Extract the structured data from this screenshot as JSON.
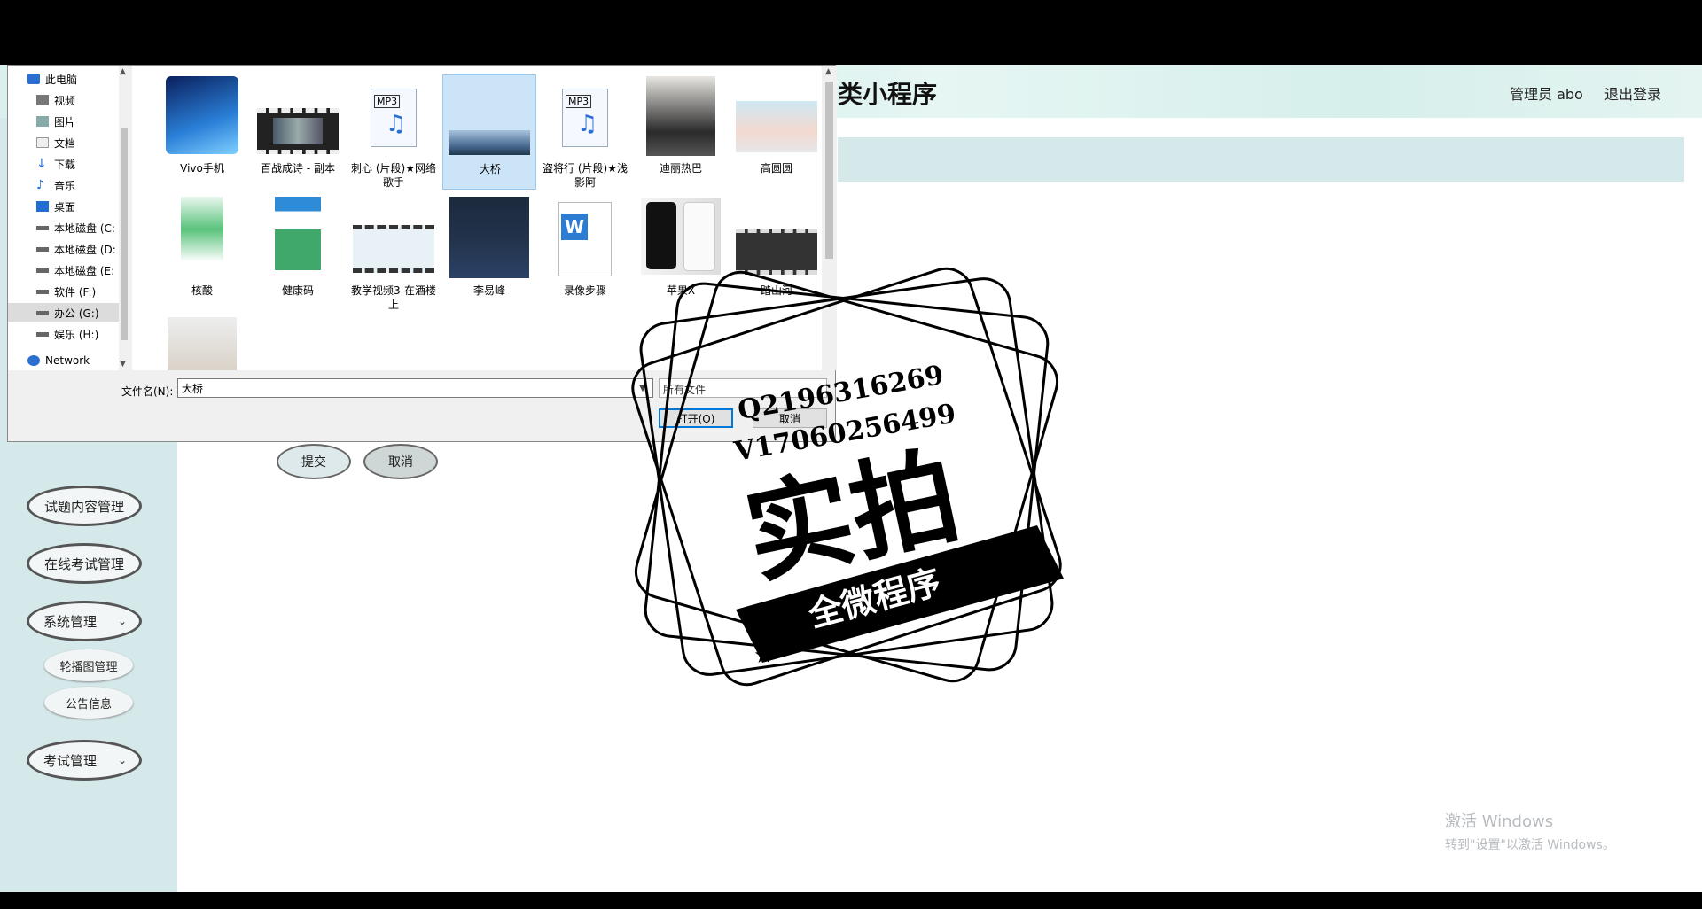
{
  "app": {
    "title": "类小程序",
    "admin_user": "管理员 abo",
    "logout": "退出登录"
  },
  "sidebar": {
    "menu": [
      {
        "label": "试题内容管理"
      },
      {
        "label": "在线考试管理"
      },
      {
        "label": "系统管理",
        "chevron": "chevron-down-icon"
      },
      {
        "label": "考试管理",
        "chevron": "chevron-down-icon"
      }
    ],
    "submenu": [
      {
        "label": "轮播图管理"
      },
      {
        "label": "公告信息"
      }
    ]
  },
  "form": {
    "submit": "提交",
    "cancel": "取消"
  },
  "dialog": {
    "nav": [
      {
        "label": "此电脑",
        "icon": "computer-icon"
      },
      {
        "label": "视频",
        "icon": "video-folder-icon"
      },
      {
        "label": "图片",
        "icon": "picture-folder-icon"
      },
      {
        "label": "文档",
        "icon": "document-folder-icon"
      },
      {
        "label": "下载",
        "icon": "download-folder-icon"
      },
      {
        "label": "音乐",
        "icon": "music-folder-icon"
      },
      {
        "label": "桌面",
        "icon": "desktop-folder-icon"
      },
      {
        "label": "本地磁盘 (C:",
        "icon": "drive-icon"
      },
      {
        "label": "本地磁盘 (D:",
        "icon": "drive-icon"
      },
      {
        "label": "本地磁盘 (E:",
        "icon": "drive-icon"
      },
      {
        "label": "软件 (F:)",
        "icon": "drive-icon"
      },
      {
        "label": "办公 (G:)",
        "icon": "drive-icon",
        "selected": true
      },
      {
        "label": "娱乐 (H:)",
        "icon": "drive-icon"
      },
      {
        "label": "Network",
        "icon": "network-icon"
      }
    ],
    "files": [
      {
        "label": "Vivo手机",
        "kind": "image"
      },
      {
        "label": "百战成诗 - 副本",
        "kind": "video"
      },
      {
        "label": "刺心 (片段)★网络歌手",
        "kind": "mp3"
      },
      {
        "label": "大桥",
        "kind": "image",
        "selected": true
      },
      {
        "label": "盗将行 (片段)★浅影阿",
        "kind": "mp3"
      },
      {
        "label": "迪丽热巴",
        "kind": "image"
      },
      {
        "label": "高圆圆",
        "kind": "image"
      },
      {
        "label": "核酸",
        "kind": "image"
      },
      {
        "label": "健康码",
        "kind": "image"
      },
      {
        "label": "教学视频3-在酒楼上",
        "kind": "video"
      },
      {
        "label": "李易峰",
        "kind": "image"
      },
      {
        "label": "录像步骤",
        "kind": "doc"
      },
      {
        "label": "苹果X",
        "kind": "image"
      },
      {
        "label": "踏山河",
        "kind": "video"
      },
      {
        "label": "",
        "kind": "image"
      }
    ],
    "mp3_badge": "MP3",
    "filename_label": "文件名(N):",
    "filename_value": "大桥",
    "filter": "所有文件",
    "open": "打开(O)",
    "cancel": "取消"
  },
  "watermark": {
    "qq": "Q2196316269",
    "wechat": "V17060256499",
    "big": "实拍",
    "banner": "全微程序"
  },
  "os_overlay": {
    "line1": "激活 Windows",
    "line2": "转到\"设置\"以激活 Windows。"
  }
}
